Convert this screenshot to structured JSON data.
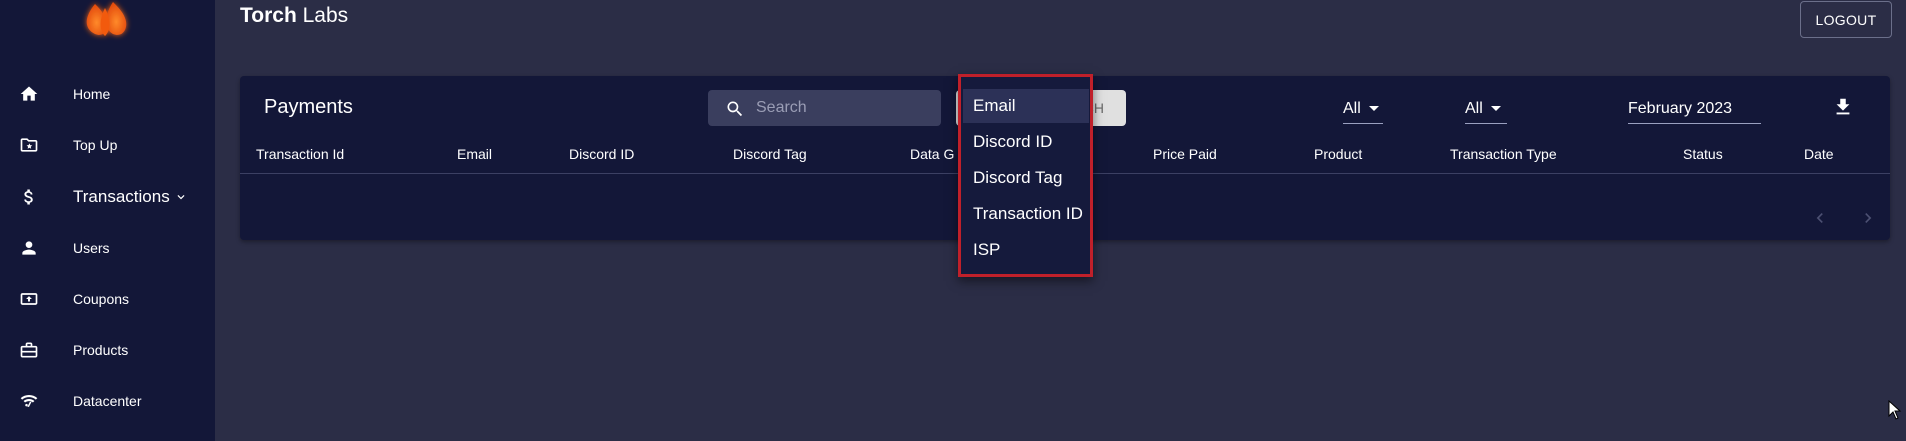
{
  "brand": {
    "bold": "Torch",
    "rest": " Labs"
  },
  "header": {
    "logout_label": "LOGOUT"
  },
  "sidebar": {
    "items": [
      {
        "label": "Home",
        "icon": "home-icon"
      },
      {
        "label": "Top Up",
        "icon": "folder-star-icon"
      },
      {
        "label": "Transactions",
        "icon": "dollar-icon",
        "expandable": true
      },
      {
        "label": "Users",
        "icon": "person-icon"
      },
      {
        "label": "Coupons",
        "icon": "coupon-upload-icon"
      },
      {
        "label": "Products",
        "icon": "briefcase-icon"
      },
      {
        "label": "Datacenter",
        "icon": "wifi-signal-icon"
      }
    ]
  },
  "payments": {
    "title": "Payments",
    "search": {
      "placeholder": "Search",
      "value": ""
    },
    "search_button_label": "SEARCH",
    "filter1": {
      "value": "All"
    },
    "filter2": {
      "value": "All"
    },
    "date_value": "February 2023",
    "columns": [
      "Transaction Id",
      "Email",
      "Discord ID",
      "Discord Tag",
      "Data G",
      "Price Paid",
      "Product",
      "Transaction Type",
      "Status",
      "Date"
    ]
  },
  "search_field_dropdown": {
    "selected": "Email",
    "options": [
      "Email",
      "Discord ID",
      "Discord Tag",
      "Transaction ID",
      "ISP"
    ]
  },
  "colors": {
    "sidebar_bg": "#131738",
    "page_bg": "#2b2d46",
    "card_bg": "#131738",
    "highlight_border": "#c0202a",
    "logo_orange": "#ff6a13"
  }
}
